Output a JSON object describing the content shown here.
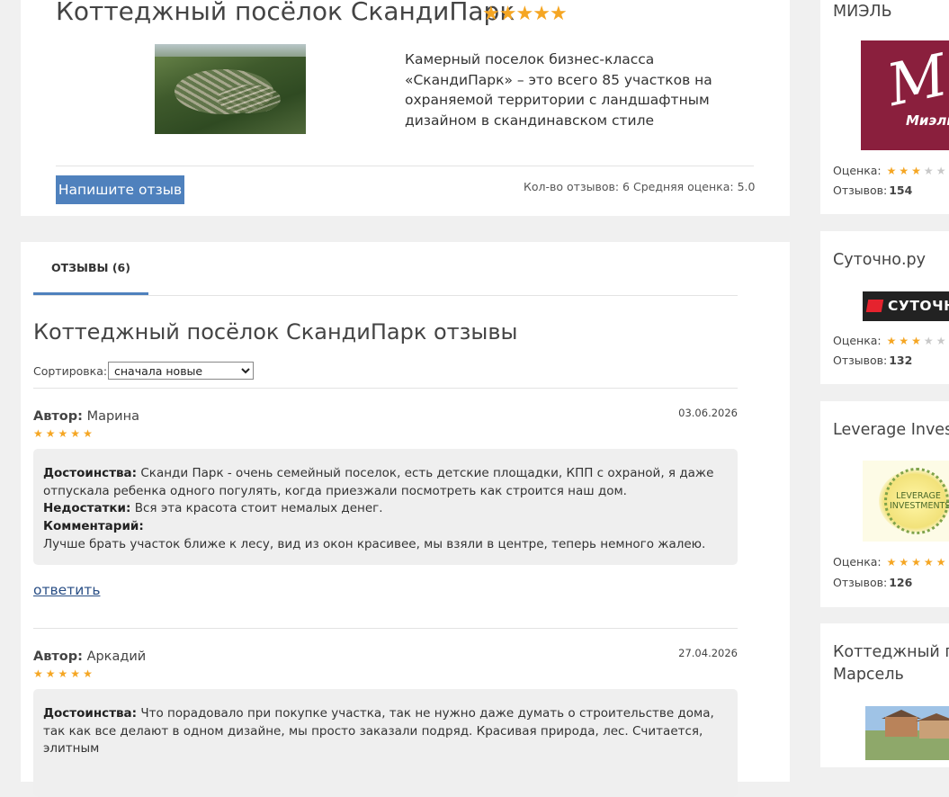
{
  "village": {
    "title": "Коттеджный посёлок СкандиПарк",
    "rating_stars": 5,
    "description": "Камерный поселок бизнес-класса «СкандиПарк» – это всего 85 участков на охраняемой территории с ландшафтным дизайном в скандинавском стиле",
    "write_review_label": "Напишите отзыв",
    "reviews_count_label": "Кол-во отзывов: 6",
    "average_rating_label": "Средняя оценка:",
    "average_rating_value": "5.0"
  },
  "reviews_section": {
    "tab_label": "ОТЗЫВЫ (6)",
    "heading": "Коттеджный посёлок СкандиПарк отзывы",
    "sort_label": "Сортировка:",
    "sort_selected": "сначала новые"
  },
  "reviews": [
    {
      "author_label": "Автор:",
      "author": "Марина",
      "date": "03.06.2026",
      "stars": 5,
      "pros_label": "Достоинства:",
      "pros": "Сканди Парк - очень семейный поселок, есть детские площадки, КПП с охраной, я даже отпускала ребенка одного погулять, когда приезжали посмотреть как строится наш дом.",
      "cons_label": "Недостатки:",
      "cons": "Вся эта красота стоит немалых денег.",
      "comment_label": "Комментарий:",
      "comment": "Лучше брать участок ближе к лесу, вид из окон красивее, мы взяли в центре, теперь немного жалею.",
      "reply_label": "ответить"
    },
    {
      "author_label": "Автор:",
      "author": "Аркадий",
      "date": "27.04.2026",
      "stars": 5,
      "pros_label": "Достоинства:",
      "pros": "Что порадовало при покупке участка, так не нужно даже думать о строительстве дома, так как все делают в одном дизайне, мы просто заказали подряд. Красивая природа, лес. Считается, элитным"
    }
  ],
  "sidebar": [
    {
      "title": "МИЭЛЬ",
      "logo_text": "Миэль",
      "rating_label": "Оценка:",
      "rating_stars": 3,
      "count_label": "Отзывов:",
      "count": "154"
    },
    {
      "title": "Суточно.ру",
      "logo_text": "СУТОЧНО",
      "rating_label": "Оценка:",
      "rating_stars": 3,
      "count_label": "Отзывов:",
      "count": "132"
    },
    {
      "title": "Leverage Invest",
      "logo_text": "LEVERAGE INVESTMENTS",
      "rating_label": "Оценка:",
      "rating_stars": 5,
      "count_label": "Отзывов:",
      "count": "126"
    },
    {
      "title": "Коттеджный по",
      "title_line2": "Марсель"
    }
  ],
  "colors": {
    "accent": "#4f81bd",
    "star": "#f5a623",
    "star_off": "#c8c8c8",
    "link": "#2a4f86"
  },
  "icons": {
    "star": "star-icon",
    "star_empty": "star-empty-icon"
  }
}
